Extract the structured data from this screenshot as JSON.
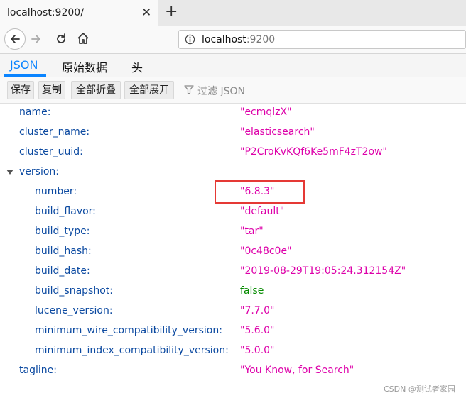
{
  "browser": {
    "tab_title": "localhost:9200/",
    "tab_close_glyph": "✕",
    "newtab_glyph": "+",
    "url_host": "localhost",
    "url_port": ":9200"
  },
  "viewer": {
    "tabs": [
      "JSON",
      "原始数据",
      "头"
    ],
    "active_tab": "JSON"
  },
  "toolbar": {
    "buttons": [
      "保存",
      "复制",
      "全部折叠",
      "全部展开"
    ],
    "filter_placeholder": "过滤 JSON"
  },
  "json": {
    "name": "\"ecmqlzX\"",
    "cluster_name": "\"elasticsearch\"",
    "cluster_uuid": "\"P2CroKvKQf6Ke5mF4zT2ow\"",
    "version_key": "version:",
    "version": {
      "number": "\"6.8.3\"",
      "build_flavor": "\"default\"",
      "build_type": "\"tar\"",
      "build_hash": "\"0c48c0e\"",
      "build_date": "\"2019-08-29T19:05:24.312154Z\"",
      "build_snapshot": "false",
      "lucene_version": "\"7.7.0\"",
      "minimum_wire_compatibility_version": "\"5.6.0\"",
      "minimum_index_compatibility_version": "\"5.0.0\""
    },
    "tagline": "\"You Know, for Search\""
  },
  "keys": {
    "name": "name:",
    "cluster_name": "cluster_name:",
    "cluster_uuid": "cluster_uuid:",
    "number": "number:",
    "build_flavor": "build_flavor:",
    "build_type": "build_type:",
    "build_hash": "build_hash:",
    "build_date": "build_date:",
    "build_snapshot": "build_snapshot:",
    "lucene_version": "lucene_version:",
    "minimum_wire_compatibility_version": "minimum_wire_compatibility_version:",
    "minimum_index_compatibility_version": "minimum_index_compatibility_version:",
    "tagline": "tagline:"
  },
  "watermark": "CSDN @测试者家园",
  "colors": {
    "key": "#0b49a0",
    "string_value": "#dd00a9",
    "bool_value": "#058b00",
    "active_tab": "#0a84ff",
    "highlight_box": "#e53935"
  }
}
